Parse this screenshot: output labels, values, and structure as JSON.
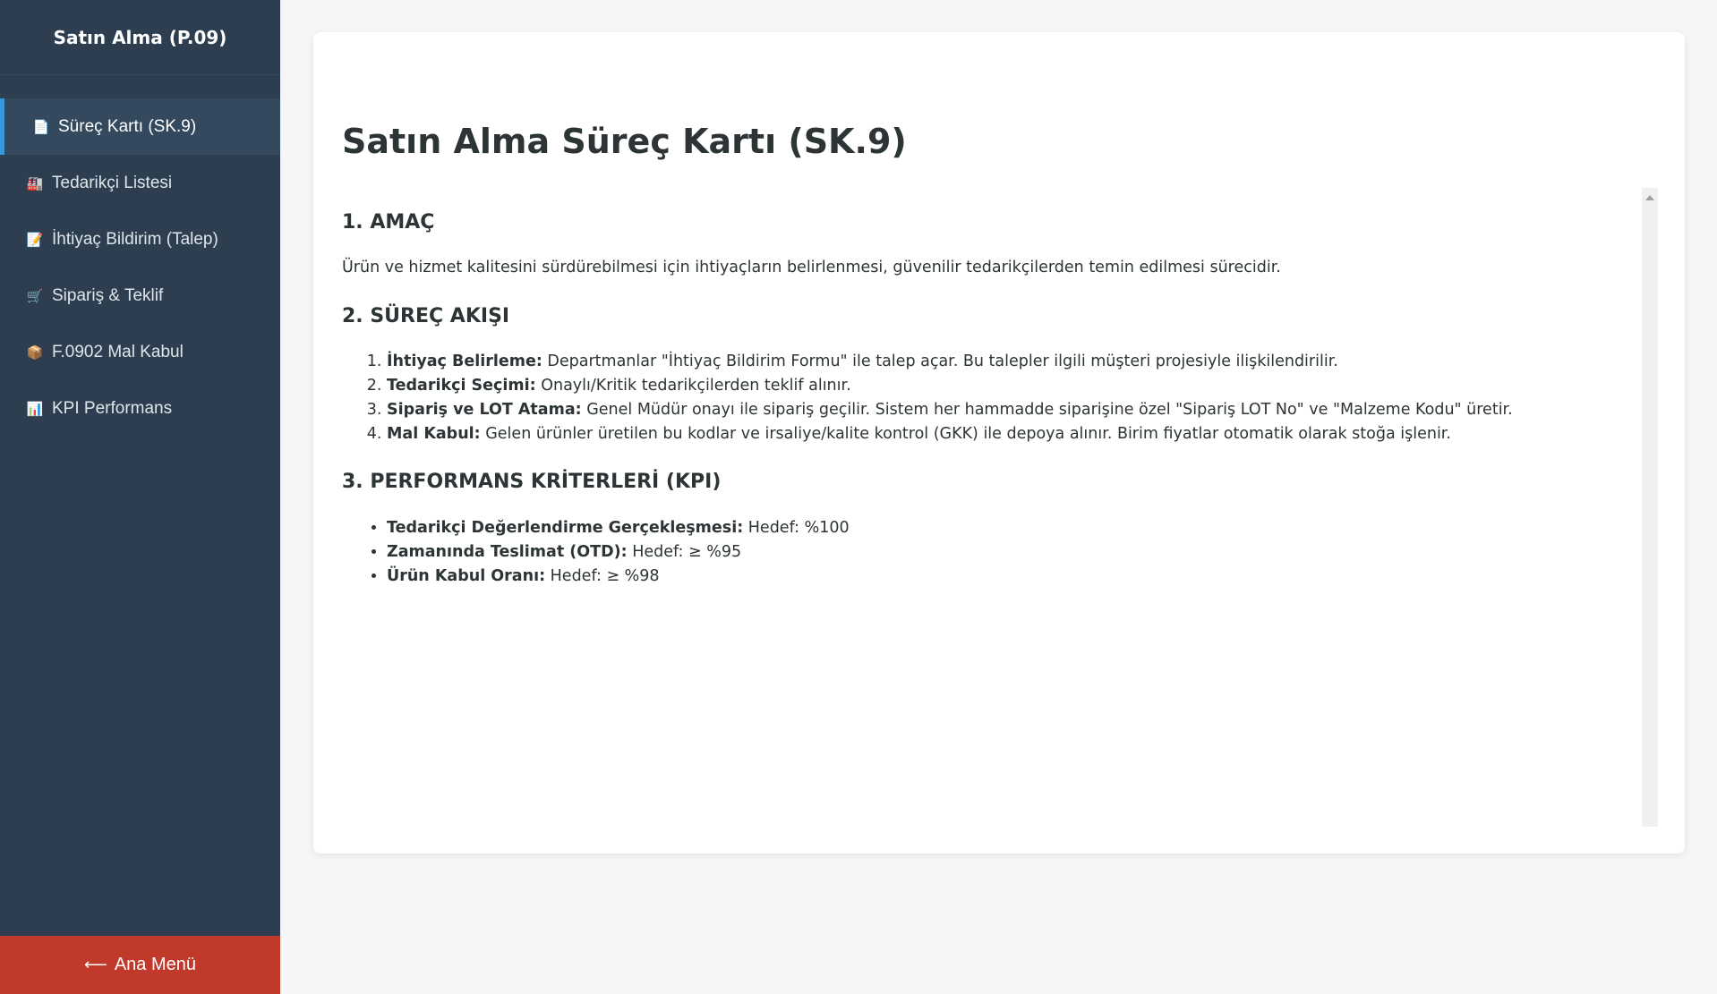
{
  "sidebar": {
    "title": "Satın Alma (P.09)",
    "items": [
      {
        "icon": "📄",
        "label": "Süreç Kartı (SK.9)",
        "active": true
      },
      {
        "icon": "🏭",
        "label": "Tedarikçi Listesi"
      },
      {
        "icon": "📝",
        "label": "İhtiyaç Bildirim (Talep)"
      },
      {
        "icon": "🛒",
        "label": "Sipariş & Teklif"
      },
      {
        "icon": "📦",
        "label": "F.0902 Mal Kabul"
      },
      {
        "icon": "📊",
        "label": "KPI Performans"
      }
    ],
    "home_button": {
      "arrow": "⟵",
      "label": "Ana Menü"
    }
  },
  "main": {
    "title": "Satın Alma Süreç Kartı (SK.9)",
    "sections": {
      "purpose": {
        "heading": "1. AMAÇ",
        "text": "Ürün ve hizmet kalitesini sürdürebilmesi için ihtiyaçların belirlenmesi, güvenilir tedarikçilerden temin edilmesi sürecidir."
      },
      "flow": {
        "heading": "2. SÜREÇ AKIŞI",
        "items": [
          {
            "label": "İhtiyaç Belirleme:",
            "text": " Departmanlar \"İhtiyaç Bildirim Formu\" ile talep açar. Bu talepler ilgili müşteri projesiyle ilişkilendirilir."
          },
          {
            "label": "Tedarikçi Seçimi:",
            "text": " Onaylı/Kritik tedarikçilerden teklif alınır."
          },
          {
            "label": "Sipariş ve LOT Atama:",
            "text": " Genel Müdür onayı ile sipariş geçilir. Sistem her hammadde siparişine özel \"Sipariş LOT No\" ve \"Malzeme Kodu\" üretir."
          },
          {
            "label": "Mal Kabul:",
            "text": " Gelen ürünler üretilen bu kodlar ve irsaliye/kalite kontrol (GKK) ile depoya alınır. Birim fiyatlar otomatik olarak stoğa işlenir."
          }
        ]
      },
      "kpi": {
        "heading": "3. PERFORMANS KRİTERLERİ (KPI)",
        "items": [
          {
            "label": "Tedarikçi Değerlendirme Gerçekleşmesi:",
            "text": " Hedef: %100"
          },
          {
            "label": "Zamanında Teslimat (OTD):",
            "text": " Hedef: ≥ %95"
          },
          {
            "label": "Ürün Kabul Oranı:",
            "text": " Hedef: ≥ %98"
          }
        ]
      }
    }
  },
  "colors": {
    "sidebar_bg": "#2c3e50",
    "active_item_bg": "#34495e",
    "active_accent": "#3498db",
    "home_button_bg": "#c0392b",
    "page_bg": "#f4f6f7"
  }
}
